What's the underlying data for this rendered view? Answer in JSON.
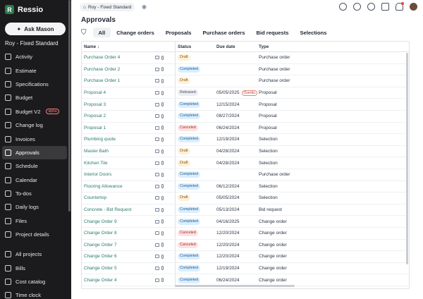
{
  "app": {
    "brand": "Ressio",
    "ask_button": "Ask Mason",
    "project_name": "Roy - Fixed Standard"
  },
  "sidebar": {
    "items": [
      {
        "label": "Activity",
        "active": false,
        "badge": ""
      },
      {
        "label": "Estimate",
        "active": false,
        "badge": ""
      },
      {
        "label": "Specifications",
        "active": false,
        "badge": ""
      },
      {
        "label": "Budget",
        "active": false,
        "badge": ""
      },
      {
        "label": "Budget V2",
        "active": false,
        "badge": "alpha"
      },
      {
        "label": "Change log",
        "active": false,
        "badge": ""
      },
      {
        "label": "Invoices",
        "active": false,
        "badge": ""
      },
      {
        "label": "Approvals",
        "active": true,
        "badge": ""
      },
      {
        "label": "Schedule",
        "active": false,
        "badge": ""
      },
      {
        "label": "Calendar",
        "active": false,
        "badge": ""
      },
      {
        "label": "To-dos",
        "active": false,
        "badge": ""
      },
      {
        "label": "Daily logs",
        "active": false,
        "badge": ""
      },
      {
        "label": "Files",
        "active": false,
        "badge": ""
      },
      {
        "label": "Project details",
        "active": false,
        "badge": ""
      }
    ],
    "bottom_items": [
      {
        "label": "All projects"
      },
      {
        "label": "Bills"
      },
      {
        "label": "Cost catalog"
      },
      {
        "label": "Time clock"
      }
    ]
  },
  "header": {
    "breadcrumb": "Roy - Fixed Standard"
  },
  "page": {
    "title": "Approvals",
    "tabs": [
      "All",
      "Change orders",
      "Proposals",
      "Purchase orders",
      "Bid requests",
      "Selections"
    ],
    "active_tab": "All"
  },
  "table": {
    "columns": {
      "name": "Name ↓",
      "status": "Status",
      "due": "Due date",
      "type": "Type"
    },
    "rows": [
      {
        "name": "Purchase Order 4",
        "status": "Draft",
        "status_kind": "draft",
        "due": "",
        "overdue": "",
        "type": "Purchase order"
      },
      {
        "name": "Purchase Order 2",
        "status": "Completed",
        "status_kind": "completed",
        "due": "",
        "overdue": "",
        "type": "Purchase order"
      },
      {
        "name": "Purchase Order 1",
        "status": "Draft",
        "status_kind": "draft",
        "due": "",
        "overdue": "",
        "type": "Purchase order"
      },
      {
        "name": "Proposal 4",
        "status": "Released",
        "status_kind": "released",
        "due": "05/05/2025",
        "overdue": "Overdu",
        "type": "Proposal"
      },
      {
        "name": "Proposal 3",
        "status": "Completed",
        "status_kind": "completed",
        "due": "12/15/2024",
        "overdue": "",
        "type": "Proposal"
      },
      {
        "name": "Proposal 2",
        "status": "Completed",
        "status_kind": "completed",
        "due": "08/27/2024",
        "overdue": "",
        "type": "Proposal"
      },
      {
        "name": "Proposal 1",
        "status": "Canceled",
        "status_kind": "canceled",
        "due": "06/24/2024",
        "overdue": "",
        "type": "Proposal"
      },
      {
        "name": "Plumbing quote",
        "status": "Completed",
        "status_kind": "completed",
        "due": "12/19/2024",
        "overdue": "",
        "type": "Selection"
      },
      {
        "name": "Master Bath",
        "status": "Draft",
        "status_kind": "draft",
        "due": "04/28/2024",
        "overdue": "",
        "type": "Selection"
      },
      {
        "name": "Kitchen Tile",
        "status": "Draft",
        "status_kind": "draft",
        "due": "04/28/2024",
        "overdue": "",
        "type": "Selection"
      },
      {
        "name": "Interior Doors",
        "status": "Completed",
        "status_kind": "completed",
        "due": "",
        "overdue": "",
        "type": "Purchase order"
      },
      {
        "name": "Flooring Allowance",
        "status": "Completed",
        "status_kind": "completed",
        "due": "06/12/2024",
        "overdue": "",
        "type": "Selection"
      },
      {
        "name": "Countertop",
        "status": "Draft",
        "status_kind": "draft",
        "due": "05/05/2024",
        "overdue": "",
        "type": "Selection"
      },
      {
        "name": "Concrete - Bid Request",
        "status": "Completed",
        "status_kind": "completed",
        "due": "05/13/2024",
        "overdue": "",
        "type": "Bid request"
      },
      {
        "name": "Change Order 9",
        "status": "Completed",
        "status_kind": "completed",
        "due": "04/16/2025",
        "overdue": "",
        "type": "Change order"
      },
      {
        "name": "Change Order 8",
        "status": "Canceled",
        "status_kind": "canceled",
        "due": "12/20/2024",
        "overdue": "",
        "type": "Change order"
      },
      {
        "name": "Change Order 7",
        "status": "Canceled",
        "status_kind": "canceled",
        "due": "12/20/2024",
        "overdue": "",
        "type": "Change order"
      },
      {
        "name": "Change Order 6",
        "status": "Completed",
        "status_kind": "completed",
        "due": "12/20/2024",
        "overdue": "",
        "type": "Change order"
      },
      {
        "name": "Change Order 5",
        "status": "Completed",
        "status_kind": "completed",
        "due": "12/19/2024",
        "overdue": "",
        "type": "Change order"
      },
      {
        "name": "Change Order 4",
        "status": "Completed",
        "status_kind": "completed",
        "due": "06/24/2024",
        "overdue": "",
        "type": "Change order"
      }
    ]
  }
}
